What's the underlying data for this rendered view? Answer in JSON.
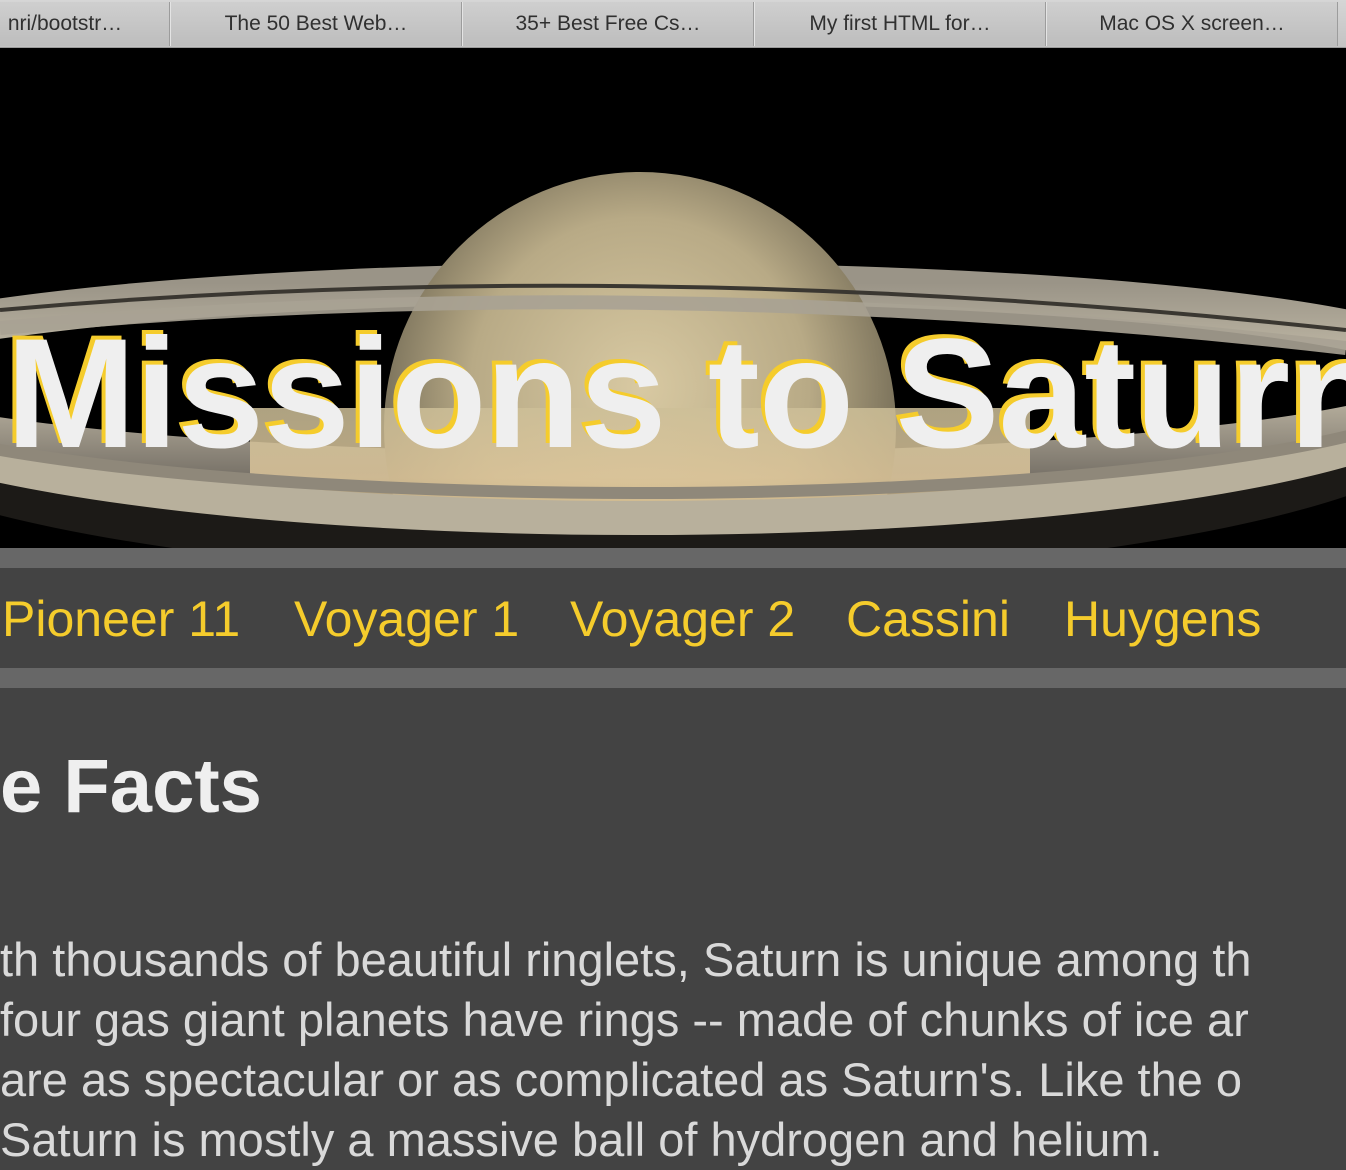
{
  "tabs": [
    {
      "label": "nri/bootstr…"
    },
    {
      "label": "The 50 Best Web…"
    },
    {
      "label": "35+ Best Free Cs…"
    },
    {
      "label": "My first HTML for…"
    },
    {
      "label": "Mac OS X screen…"
    }
  ],
  "hero": {
    "title": "Missions to Saturn"
  },
  "nav": {
    "items": [
      {
        "label": "Pioneer 11"
      },
      {
        "label": "Voyager 1"
      },
      {
        "label": "Voyager 2"
      },
      {
        "label": "Cassini"
      },
      {
        "label": "Huygens"
      }
    ]
  },
  "main": {
    "heading": "e Facts",
    "paragraph_lines": [
      "th thousands of beautiful ringlets, Saturn is unique among th",
      "four gas giant planets have rings -- made of chunks of ice ar",
      "are as spectacular or as complicated as Saturn's. Like the o",
      "Saturn is mostly a massive ball of hydrogen and helium."
    ]
  },
  "colors": {
    "accent_yellow": "#f5cc2c",
    "page_background": "#434343",
    "nav_band": "#676767",
    "heading_text": "#efefef"
  }
}
